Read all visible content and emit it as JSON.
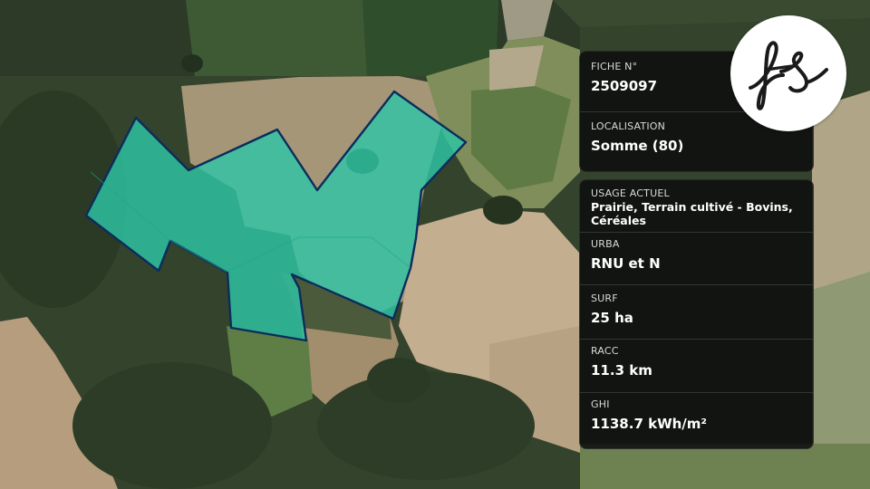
{
  "brand": {
    "logo_text": "fs"
  },
  "card_top": {
    "fiche_label": "FICHE N°",
    "fiche_value": "2509097",
    "loc_label": "LOCALISATION",
    "loc_value": "Somme (80)"
  },
  "card_bottom": {
    "usage_label": "USAGE ACTUEL",
    "usage_value": "Prairie, Terrain cultivé - Bovins, Céréales",
    "urba_label": "URBA",
    "urba_value": "RNU et N",
    "surf_label": "SURF",
    "surf_value": "25 ha",
    "racc_label": "RACC",
    "racc_value": "11.3 km",
    "ghi_label": "GHI",
    "ghi_value": "1138.7 kWh/m²"
  },
  "colors": {
    "parcel_fill": "#2ec4a5",
    "parcel_stroke": "#0c2c5c",
    "card_bg": "#0e0e0e"
  }
}
